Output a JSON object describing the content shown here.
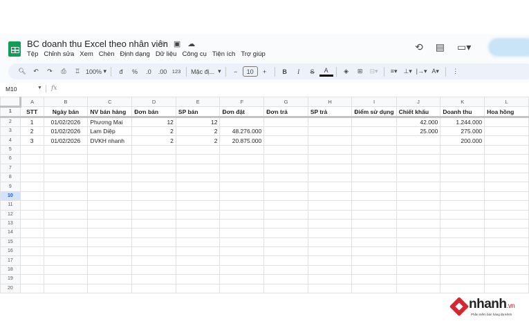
{
  "doc": {
    "title": "BC doanh thu Excel theo nhân viên"
  },
  "menu": [
    "Tệp",
    "Chỉnh sửa",
    "Xem",
    "Chèn",
    "Định dạng",
    "Dữ liệu",
    "Công cụ",
    "Tiện ích",
    "Trợ giúp"
  ],
  "toolbar": {
    "zoom": "100%",
    "currency": "đ",
    "percent": "%",
    "dec_decrease": ".0",
    "dec_increase": ".00",
    "format_123": "123",
    "font": "Mặc đị...",
    "font_size": "10",
    "bold": "B",
    "italic": "I",
    "text_color": "A"
  },
  "formula_bar": {
    "name_box": "M10",
    "fx": "fx"
  },
  "grid": {
    "columns": [
      "A",
      "B",
      "C",
      "D",
      "E",
      "F",
      "G",
      "H",
      "I",
      "J",
      "K",
      "L"
    ],
    "row_numbers": [
      1,
      2,
      3,
      4,
      5,
      6,
      7,
      8,
      9,
      10,
      11,
      12,
      13,
      14,
      15,
      16,
      17,
      18,
      19,
      20
    ],
    "selected_row": 10,
    "headers": [
      "STT",
      "Ngày bán",
      "NV bán hàng",
      "Đơn bán",
      "SP bán",
      "Đơn đặt",
      "Đơn trả",
      "SP trả",
      "Điểm sử dụng",
      "Chiết khấu",
      "Doanh thu",
      "Hoa hồng"
    ],
    "rows": [
      [
        "1",
        "01/02/2026",
        "Phương Mai",
        "12",
        "12",
        "",
        "",
        "",
        "",
        "42.000",
        "1.244.000",
        ""
      ],
      [
        "2",
        "01/02/2026",
        "Lam Diệp",
        "2",
        "2",
        "48.276.000",
        "",
        "",
        "",
        "25.000",
        "275.000",
        ""
      ],
      [
        "3",
        "01/02/2026",
        "DVKH nhanh",
        "2",
        "2",
        "20.875.000",
        "",
        "",
        "",
        "",
        "200.000",
        ""
      ]
    ]
  },
  "brand": {
    "name": "nhanh",
    "tld": ".vn",
    "tagline": "Phần mềm bán hàng đa kênh",
    "color": "#d7262d"
  },
  "colors": {
    "sheets_green": "#0f9d58",
    "toolbar_bg": "#edf2fa",
    "selected_header": "#d3e3fd"
  }
}
